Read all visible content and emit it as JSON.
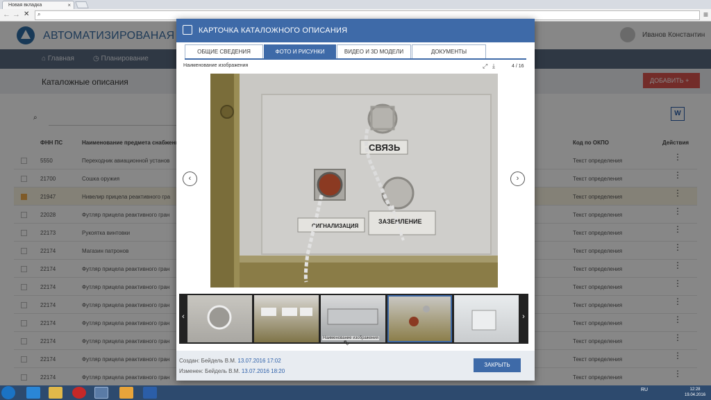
{
  "browser": {
    "tab_title": "Новая вкладка",
    "tab_close": "×",
    "back_icon": "back-arrow-icon",
    "forward_icon": "forward-arrow-icon",
    "reload_label": "✕",
    "search_symbol": "🔍",
    "menu_label": "≡"
  },
  "app": {
    "title": "АВТОМАТИЗИРОВАНАЯ СИСТЕ",
    "user": "Иванов Константин",
    "nav": [
      {
        "label": "Главная",
        "icon": "⌂"
      },
      {
        "label": "Планирование",
        "icon": "◷"
      }
    ],
    "page_title": "Каталожные описания",
    "add_button": "ДОБАВИТЬ +",
    "word_icon_label": "W",
    "search_icon_symbol": "⌕"
  },
  "table": {
    "headers": {
      "fnn": "ФНН ПС",
      "name": "Наименование предмета снабжени",
      "okpo": "Код по ОКПО",
      "actions": "Действия"
    },
    "rows": [
      {
        "fnn": "5550",
        "name": "Переходник авиационной установ",
        "okpo": "Текст определения",
        "checked": false
      },
      {
        "fnn": "21700",
        "name": "Сошка оружия",
        "okpo": "Текст определения",
        "checked": false
      },
      {
        "fnn": "21947",
        "name": "Нивелир прицела реактивного гра",
        "okpo": "Текст определения",
        "checked": true
      },
      {
        "fnn": "22028",
        "name": "Футляр прицела реактивного гран",
        "okpo": "Текст определения",
        "checked": false
      },
      {
        "fnn": "22173",
        "name": "Рукоятка винтовки",
        "okpo": "Текст определения",
        "checked": false
      },
      {
        "fnn": "22174",
        "name": "Магазин патронов",
        "okpo": "Текст определения",
        "checked": false
      },
      {
        "fnn": "22174",
        "name": "Футляр прицела реактивного гран",
        "okpo": "Текст определения",
        "checked": false
      },
      {
        "fnn": "22174",
        "name": "Футляр прицела реактивного гран",
        "okpo": "Текст определения",
        "checked": false
      },
      {
        "fnn": "22174",
        "name": "Футляр прицела реактивного гран",
        "okpo": "Текст определения",
        "checked": false
      },
      {
        "fnn": "22174",
        "name": "Футляр прицела реактивного гран",
        "okpo": "Текст определения",
        "checked": false
      },
      {
        "fnn": "22174",
        "name": "Футляр прицела реактивного гран",
        "okpo": "Текст определения",
        "checked": false
      },
      {
        "fnn": "22174",
        "name": "Футляр прицела реактивного гран",
        "okpo": "Текст определения",
        "checked": false
      },
      {
        "fnn": "22174",
        "name": "Футляр прицела реактивного гран",
        "okpo": "Текст определения",
        "checked": false
      }
    ],
    "row_action_symbol": "⋮"
  },
  "modal": {
    "title": "КАРТОЧКА КАТАЛОЖНОГО ОПИСАНИЯ",
    "tabs": [
      {
        "label": "ОБЩИЕ СВЕДЕНИЯ",
        "active": false
      },
      {
        "label": "ФОТО И РИСУНКИ",
        "active": true
      },
      {
        "label": "ВИДЕО И 3D МОДЕЛИ",
        "active": false
      },
      {
        "label": "ДОКУМЕНТЫ",
        "active": false
      }
    ],
    "image_name": "Наименование изображения",
    "counter": "4 / 16",
    "fullscreen_symbol": "⤢",
    "download_symbol": "⤓",
    "photo_plate_1": "СВЯЗЬ",
    "photo_plate_2": "СИГНАЛИЗАЦИЯ",
    "photo_plate_3": "ЗАЗЕМЛЕНИЕ",
    "prev_symbol": "‹",
    "next_symbol": "›",
    "thumb_prev_symbol": "‹",
    "thumb_next_symbol": "›",
    "thumb_tooltip": "Наименование изображения",
    "created_label": "Создан: Бейдель В.М.",
    "created_date": "13.07.2016 17:02",
    "modified_label": "Изменен: Бейдель В.М.",
    "modified_date": "13.07.2016 18:20",
    "close_button": "ЗАКРЫТЬ"
  },
  "taskbar": {
    "lang": "RU",
    "time": "12:28",
    "date": "19.04.2016"
  }
}
